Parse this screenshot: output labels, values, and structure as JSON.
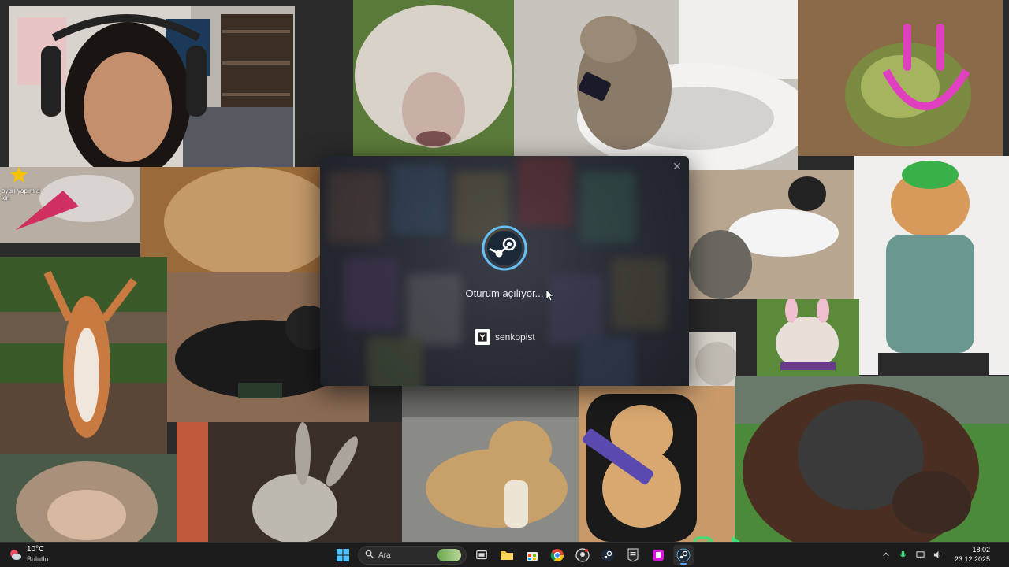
{
  "steam_dialog": {
    "status_text": "Oturum açılıyor...",
    "account_name": "senkopist",
    "close_icon": "close-icon",
    "logo_icon": "steam-logo-icon"
  },
  "overlay": {
    "star_caption": "oydrı yapım a kin",
    "instagram_icon": "instagram-icon",
    "tiktok_icon": "tiktok-icon"
  },
  "taskbar": {
    "weather_temp": "10°C",
    "weather_condition": "Bulutlu",
    "search_label": "Ara",
    "clock_time": "18:02",
    "clock_date": "23.12.2025",
    "apps": [
      "windows-start-icon",
      "task-view-icon",
      "file-explorer-icon",
      "store-icon",
      "chrome-icon",
      "github-icon",
      "steam-icon",
      "epic-games-icon",
      "twitch-icon",
      "steam-active-icon"
    ],
    "tray": [
      "chevron-up-icon",
      "microphone-icon",
      "display-icon",
      "speaker-icon"
    ]
  },
  "colors": {
    "taskbar_bg": "#1c1c1c",
    "dialog_bg": "#2a2e37",
    "accent": "#5ba3ff",
    "steam_blue": "#66c0f4"
  }
}
